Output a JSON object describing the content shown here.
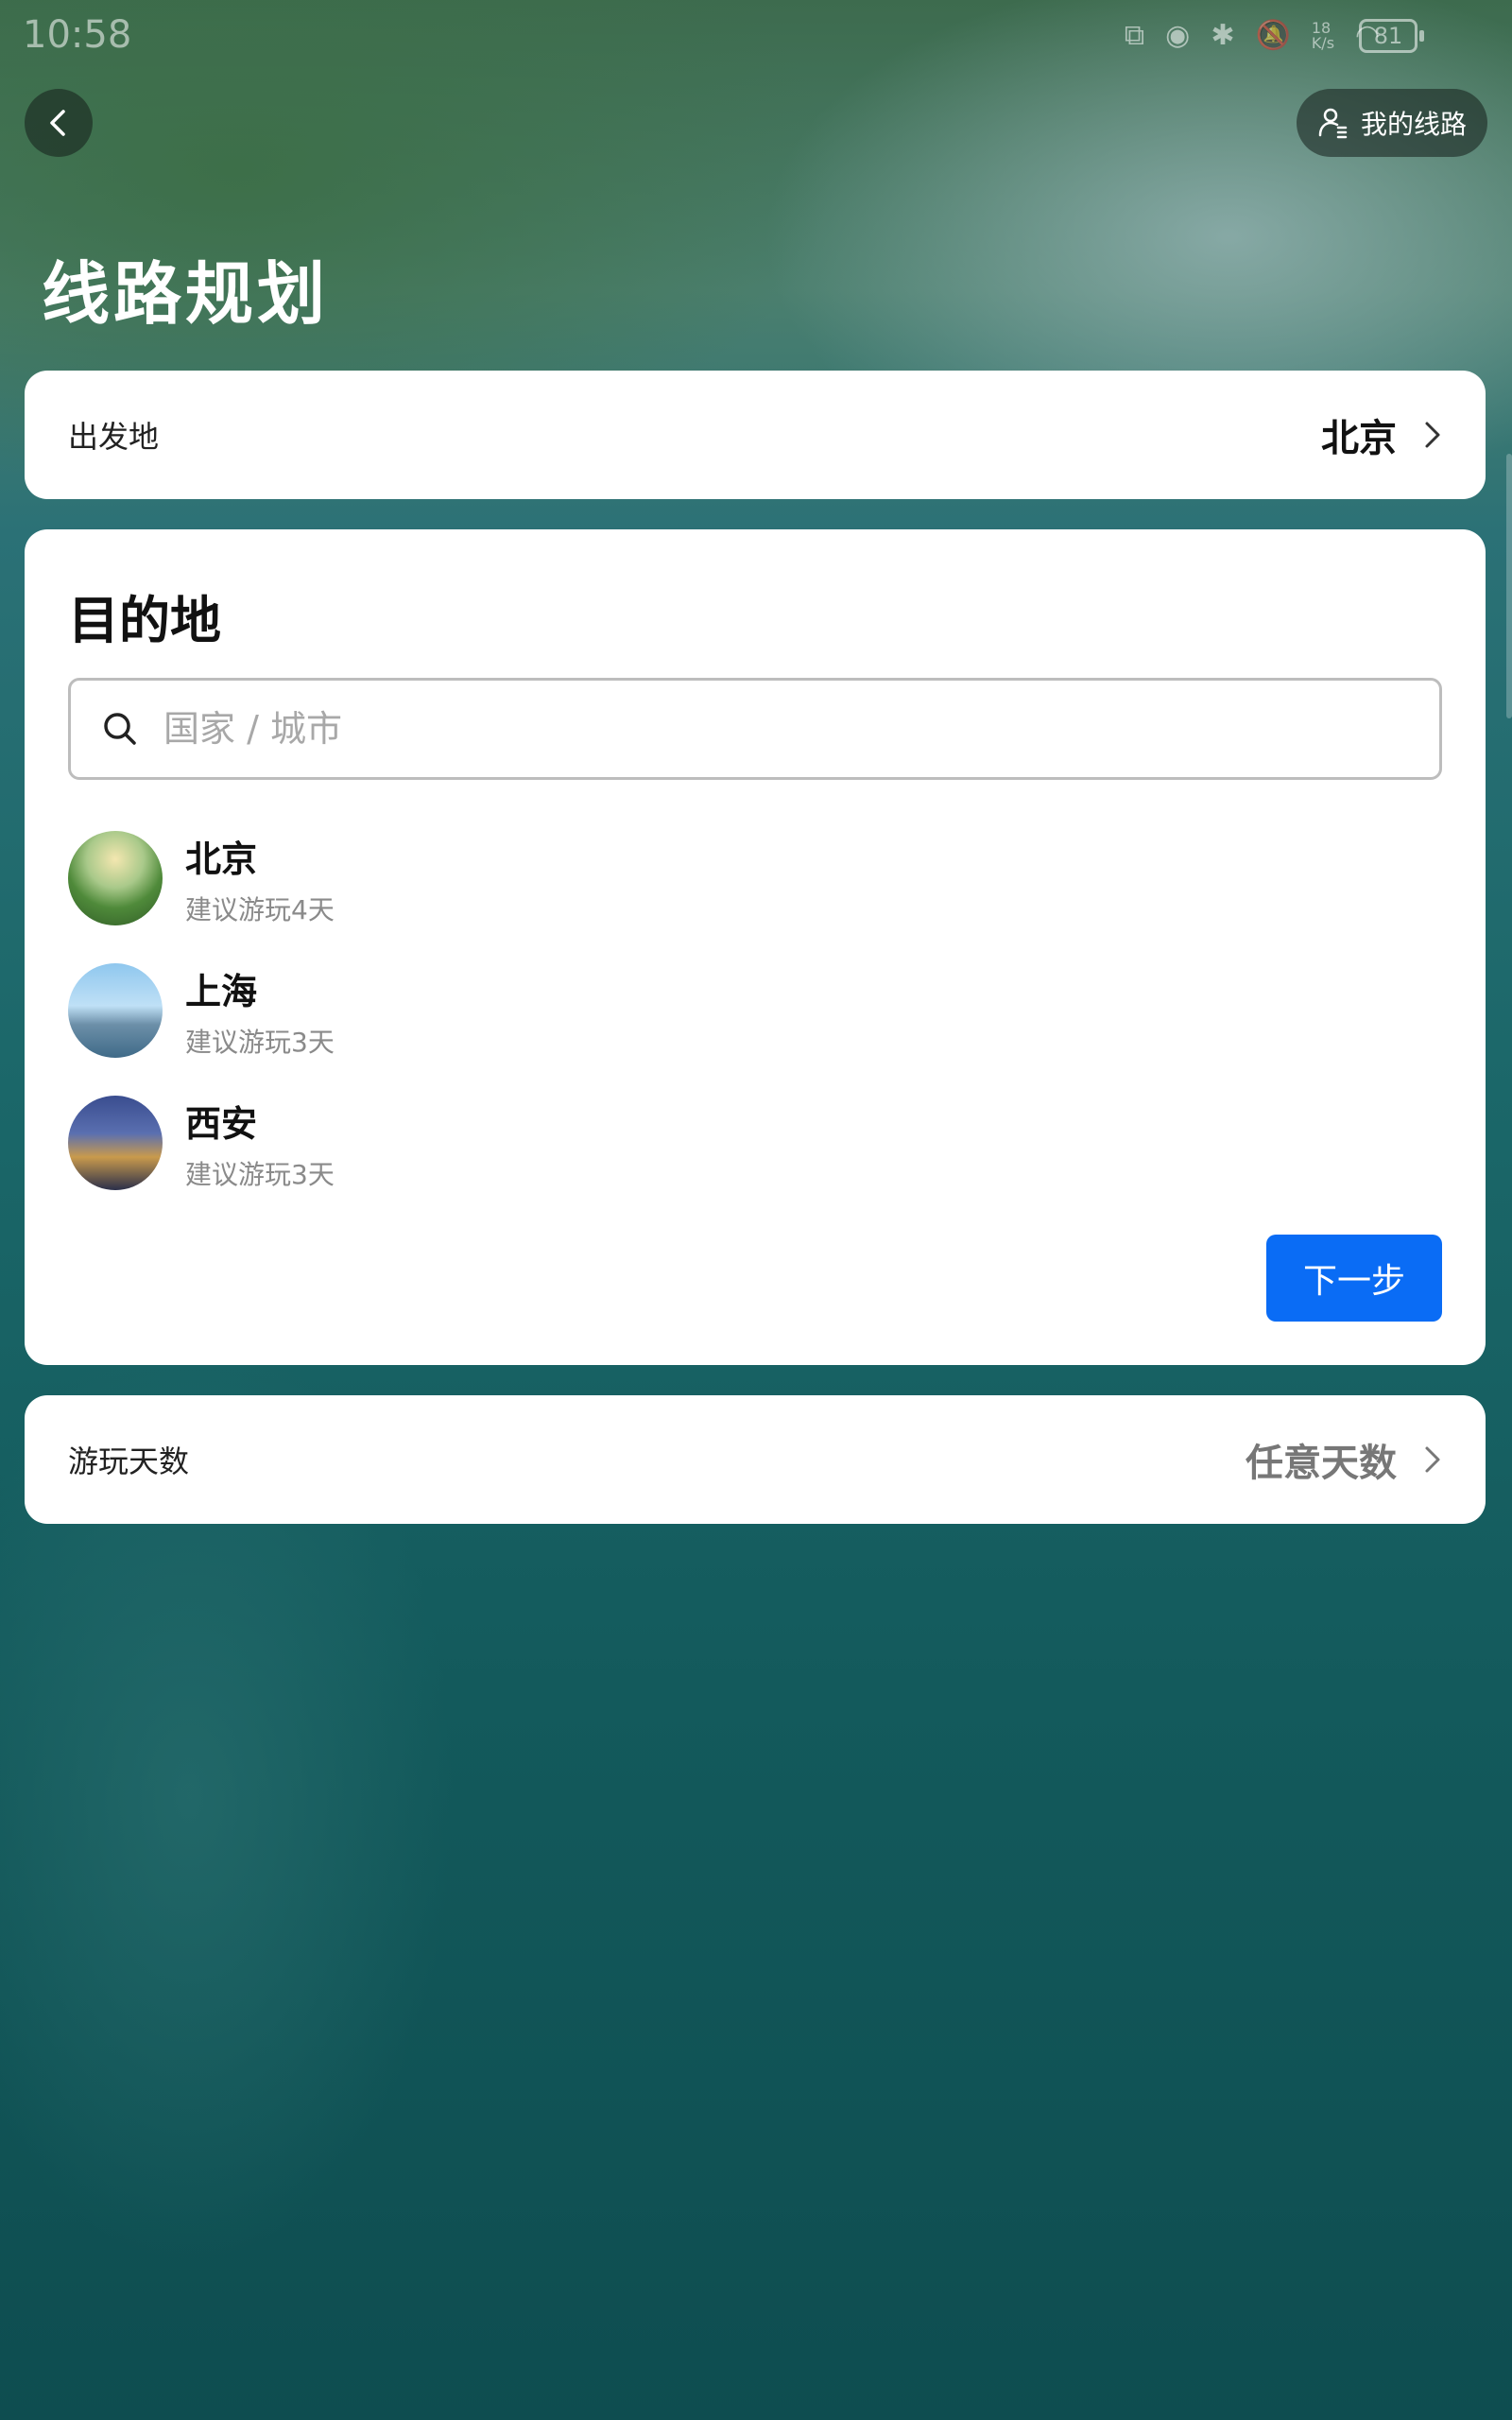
{
  "status_bar": {
    "time": "10:58",
    "battery": "81",
    "net_speed": "18 K/s"
  },
  "header": {
    "my_routes_label": "我的线路",
    "page_title": "线路规划"
  },
  "origin": {
    "label": "出发地",
    "value": "北京"
  },
  "destination": {
    "title": "目的地",
    "search_placeholder": "国家 / 城市",
    "cities": [
      {
        "name": "北京",
        "suggestion": "建议游玩4天"
      },
      {
        "name": "上海",
        "suggestion": "建议游玩3天"
      },
      {
        "name": "西安",
        "suggestion": "建议游玩3天"
      }
    ],
    "next_label": "下一步"
  },
  "days": {
    "label": "游玩天数",
    "value": "任意天数"
  },
  "colors": {
    "primary": "#0a6cf5",
    "card": "#ffffff",
    "muted_text": "#8a8a8a"
  }
}
